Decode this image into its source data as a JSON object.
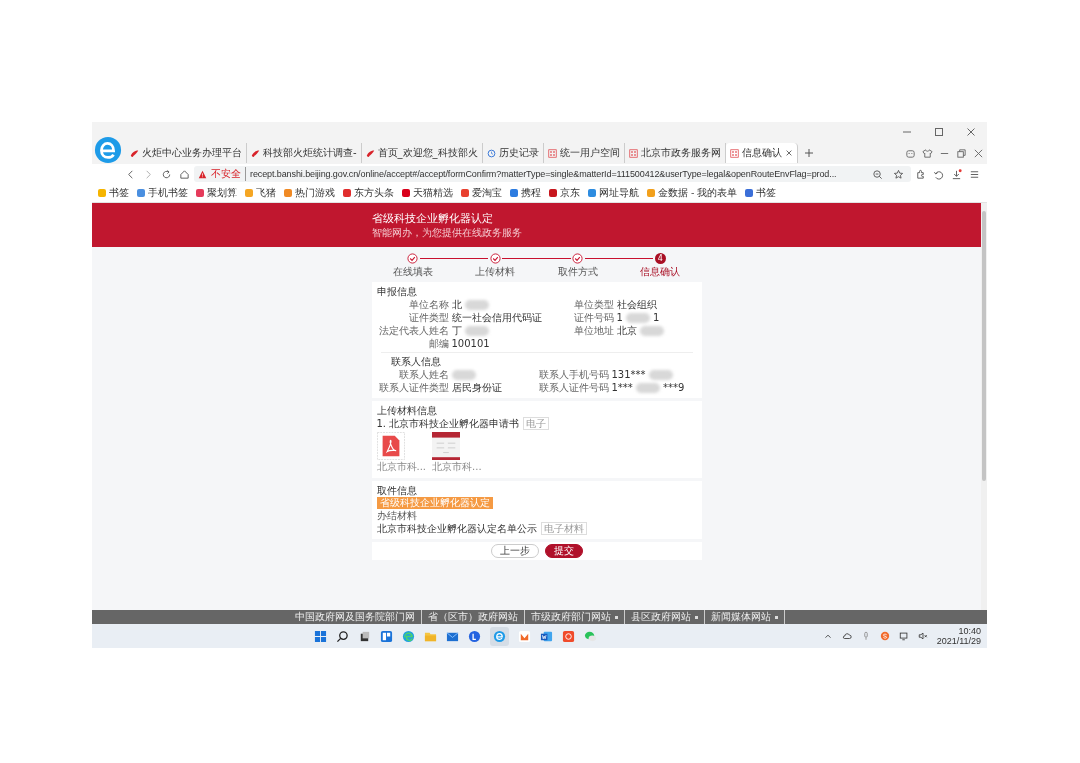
{
  "browser": {
    "tabs": [
      {
        "label": "火炬中心业务办理平台",
        "selected": false
      },
      {
        "label": "科技部火炬统计调查-",
        "selected": false
      },
      {
        "label": "首页_欢迎您_科技部火",
        "selected": false
      },
      {
        "label": "历史记录",
        "selected": false
      },
      {
        "label": "统一用户空间",
        "selected": false
      },
      {
        "label": "北京市政务服务网",
        "selected": false
      },
      {
        "label": "信息确认",
        "selected": true
      }
    ],
    "security": "不安全",
    "url": "recept.banshi.beijing.gov.cn/online/accept#/accept/formConfirm?matterType=single&matterId=111500412&userType=legal&openRouteEnvFlag=prod...",
    "bookmarks": [
      {
        "label": "书签",
        "color": "#f5b400"
      },
      {
        "label": "手机书签",
        "color": "#4a8fe0"
      },
      {
        "label": "聚划算",
        "color": "#e53b5b"
      },
      {
        "label": "飞猪",
        "color": "#f5a623"
      },
      {
        "label": "热门游戏",
        "color": "#f08a24"
      },
      {
        "label": "东方头条",
        "color": "#e02d2d"
      },
      {
        "label": "天猫精选",
        "color": "#d9001b"
      },
      {
        "label": "爱淘宝",
        "color": "#e8402f"
      },
      {
        "label": "携程",
        "color": "#2d7ce0"
      },
      {
        "label": "京东",
        "color": "#c7161d"
      },
      {
        "label": "网址导航",
        "color": "#2d8ce0"
      },
      {
        "label": "金数据 - 我的表单",
        "color": "#f2a01c"
      },
      {
        "label": "书签",
        "color": "#3b6fd8"
      }
    ]
  },
  "header": {
    "title": "省级科技企业孵化器认定",
    "subtitle": "智能网办，为您提供在线政务服务"
  },
  "steps": [
    {
      "label": "在线填表",
      "done": true
    },
    {
      "label": "上传材料",
      "done": true
    },
    {
      "label": "取件方式",
      "done": true
    },
    {
      "label": "信息确认",
      "number": "4",
      "done": false
    }
  ],
  "applicant": {
    "title": "申报信息",
    "fields": [
      {
        "label": "单位名称",
        "value": "北",
        "redacted": true
      },
      {
        "label": "单位类型",
        "value": "社会组织"
      },
      {
        "label": "证件类型",
        "value": "统一社会信用代码证"
      },
      {
        "label": "证件号码",
        "value": "1",
        "value_end": "1",
        "redacted": true
      },
      {
        "label": "法定代表人姓名",
        "value": "丁",
        "redacted": true
      },
      {
        "label": "单位地址",
        "value": "北京",
        "redacted": true
      },
      {
        "label": "邮编",
        "value": "100101"
      }
    ]
  },
  "contact": {
    "title": "联系人信息",
    "fields": [
      {
        "label": "联系人姓名",
        "redacted": true
      },
      {
        "label": "联系人手机号码",
        "value": "131***",
        "redacted": true
      },
      {
        "label": "联系人证件类型",
        "value": "居民身份证"
      },
      {
        "label": "联系人证件号码",
        "value": "1***",
        "value_end": "***9",
        "redacted": true
      }
    ]
  },
  "materials": {
    "title": "上传材料信息",
    "item": "1. 北京市科技企业孵化器申请书",
    "item_tag": "电子",
    "files": [
      {
        "kind": "pdf",
        "name": "北京市科..."
      },
      {
        "kind": "image",
        "name": "北京市科..."
      }
    ]
  },
  "pickup": {
    "title": "取件信息",
    "tag": "省级科技企业孵化器认定",
    "subtitle": "办结材料",
    "result": "北京市科技企业孵化器认定名单公示",
    "result_tag": "电子材料"
  },
  "buttons": [
    {
      "label": "上一步",
      "primary": false
    },
    {
      "label": "提交",
      "primary": true
    }
  ],
  "footer_links": [
    {
      "label": "中国政府网及国务院部门网",
      "has_menu": false
    },
    {
      "label": "省（区市）政府网站",
      "has_menu": false
    },
    {
      "label": "市级政府部门网站",
      "has_menu": true
    },
    {
      "label": "县区政府网站",
      "has_menu": true
    },
    {
      "label": "新闻媒体网站",
      "has_menu": true
    }
  ],
  "clock": {
    "time": "10:40",
    "date": "2021/11/29"
  }
}
